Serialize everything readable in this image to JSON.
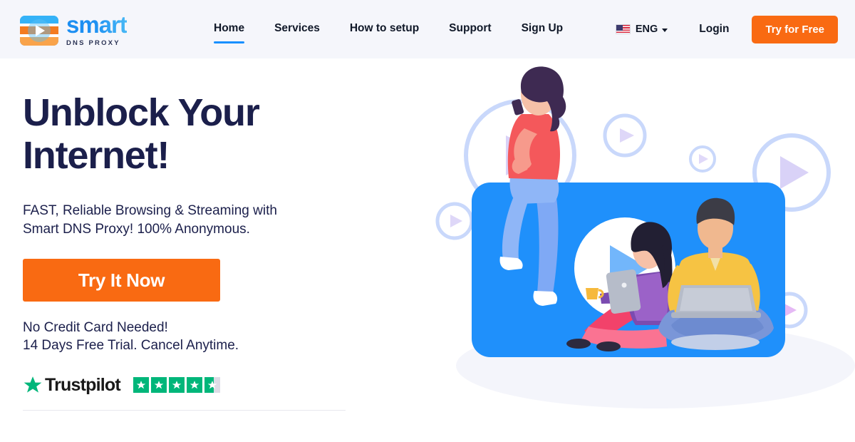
{
  "header": {
    "logo": {
      "brand": "smart",
      "tagline": "DNS PROXY",
      "mark_icon": "play-video-logo-icon"
    },
    "nav": [
      {
        "label": "Home",
        "active": true
      },
      {
        "label": "Services",
        "active": false
      },
      {
        "label": "How to setup",
        "active": false
      },
      {
        "label": "Support",
        "active": false
      },
      {
        "label": "Sign Up",
        "active": false
      }
    ],
    "language": {
      "label": "ENG",
      "flag_icon": "us-flag-icon",
      "caret_icon": "chevron-down-icon"
    },
    "login_label": "Login",
    "try_free_label": "Try for Free",
    "accent_color": "#f96a12",
    "nav_active_color": "#1890ff",
    "background": "#f5f6fb"
  },
  "hero": {
    "title_line1": "Unblock Your",
    "title_line2": "Internet!",
    "subtitle_line1": "FAST, Reliable Browsing & Streaming with",
    "subtitle_line2": "Smart DNS Proxy! 100% Anonymous.",
    "cta_label": "Try It Now",
    "note_line1": "No Credit Card Needed!",
    "note_line2": "14 Days Free Trial. Cancel Anytime.",
    "title_color": "#1b1f4b"
  },
  "trustpilot": {
    "name": "Trustpilot",
    "star_icon": "trustpilot-star-icon",
    "rating_boxes": 5,
    "filled_boxes": 4,
    "partial_fraction": 0.6,
    "star_color": "#00b67a",
    "empty_color": "#dcdce6"
  },
  "illustration": {
    "name": "video-streaming-people-illustration",
    "player_color": "#1f90fb",
    "play_button_icon": "play-icon",
    "decor_circles": 5,
    "figures": [
      "woman-with-phone",
      "woman-with-tablet",
      "man-with-laptop"
    ]
  }
}
